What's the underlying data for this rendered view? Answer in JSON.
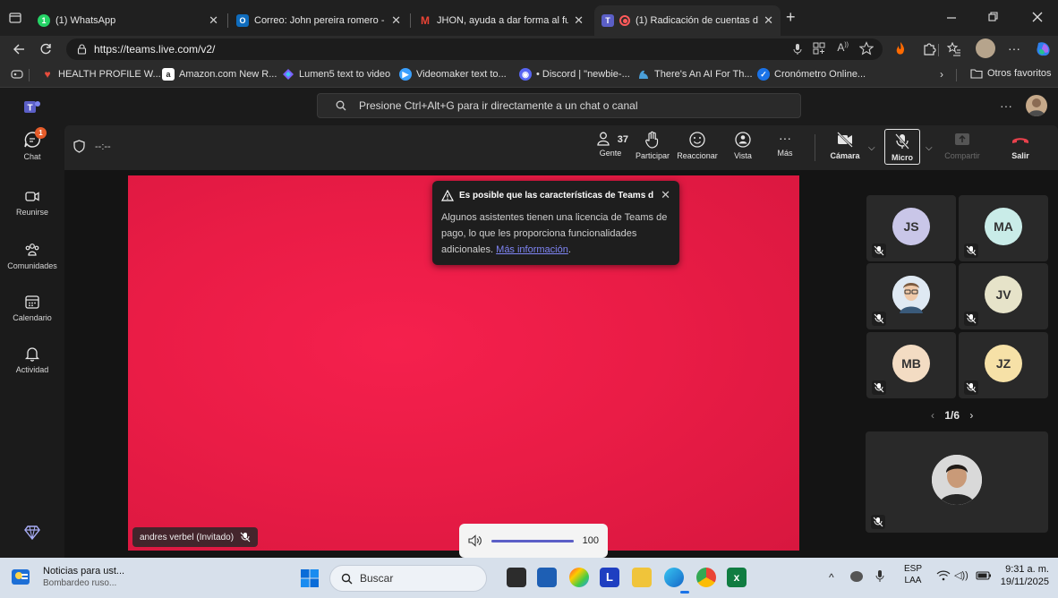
{
  "browser": {
    "tabs": [
      {
        "title": "(1) WhatsApp",
        "favicon_text": "1",
        "favicon_color": "#25d366"
      },
      {
        "title": "Correo: John pereira romero - Ou",
        "favicon_text": "O",
        "favicon_color": "#0f6cbd"
      },
      {
        "title": "JHON, ayuda a dar forma al futur",
        "favicon_text": "M",
        "favicon_color": "#ea4335"
      },
      {
        "title": "(1) Radicación de cuentas de",
        "favicon_text": "T",
        "favicon_color": "#5b5fc7"
      }
    ],
    "new_tab": "+",
    "url": "https://teams.live.com/v2/",
    "bookmarks": [
      {
        "label": "HEALTH PROFILE W...",
        "color": "#c0392b"
      },
      {
        "label": "Amazon.com New R...",
        "color": "#ff9900"
      },
      {
        "label": "Lumen5 text to video",
        "color": "#7b61ff"
      },
      {
        "label": "Videomaker text to...",
        "color": "#3aa0ff"
      },
      {
        "label": "• Discord | \"newbie-...",
        "color": "#5865f2"
      },
      {
        "label": "There's An AI For Th...",
        "color": "#4a9fd8"
      },
      {
        "label": "Cronómetro Online...",
        "color": "#1a73e8"
      }
    ],
    "other_favorites": "Otros favoritos"
  },
  "teams": {
    "search_placeholder": "Presione Ctrl+Alt+G para ir directamente a un chat o canal",
    "rail": [
      {
        "label": "Chat",
        "badge": "1"
      },
      {
        "label": "Reunirse"
      },
      {
        "label": "Comunidades"
      },
      {
        "label": "Calendario"
      },
      {
        "label": "Actividad"
      }
    ],
    "meeting_timer": "--:--",
    "people_count": "37",
    "controls": {
      "people": "Gente",
      "raise": "Participar",
      "react": "Reaccionar",
      "view": "Vista",
      "more": "Más",
      "camera": "Cámara",
      "mic": "Micro",
      "share": "Compartir",
      "leave": "Salir"
    },
    "notice": {
      "title": "Es posible que las características de Teams di...",
      "body": "Algunos asistentes tienen una licencia de Teams de pago, lo que les proporciona funcionalidades adicionales.",
      "link": "Más información",
      "period": "."
    },
    "main_participant": "andres verbel (Invitado)",
    "volume": "100",
    "volume_level": 1.0,
    "participants": [
      {
        "initials": "JS",
        "color": "#c9c6e8"
      },
      {
        "initials": "MA",
        "color": "#c9ece8"
      },
      {
        "initials": "",
        "color": "#dfe9f3",
        "photo": true
      },
      {
        "initials": "JV",
        "color": "#e6e3c9"
      },
      {
        "initials": "MB",
        "color": "#f3dcc3"
      },
      {
        "initials": "JZ",
        "color": "#f6e1a7"
      }
    ],
    "pager": "1/6"
  },
  "taskbar": {
    "news_title": "Noticias para ust...",
    "news_sub": "Bombardeo ruso...",
    "search": "Buscar",
    "lang1": "ESP",
    "lang2": "LAA",
    "time": "9:31 a. m.",
    "date": "19/11/2025"
  },
  "colors": {
    "teams_purple": "#5b5fc7",
    "leave_red": "#e8414c",
    "video_red": "#ea1c46"
  }
}
